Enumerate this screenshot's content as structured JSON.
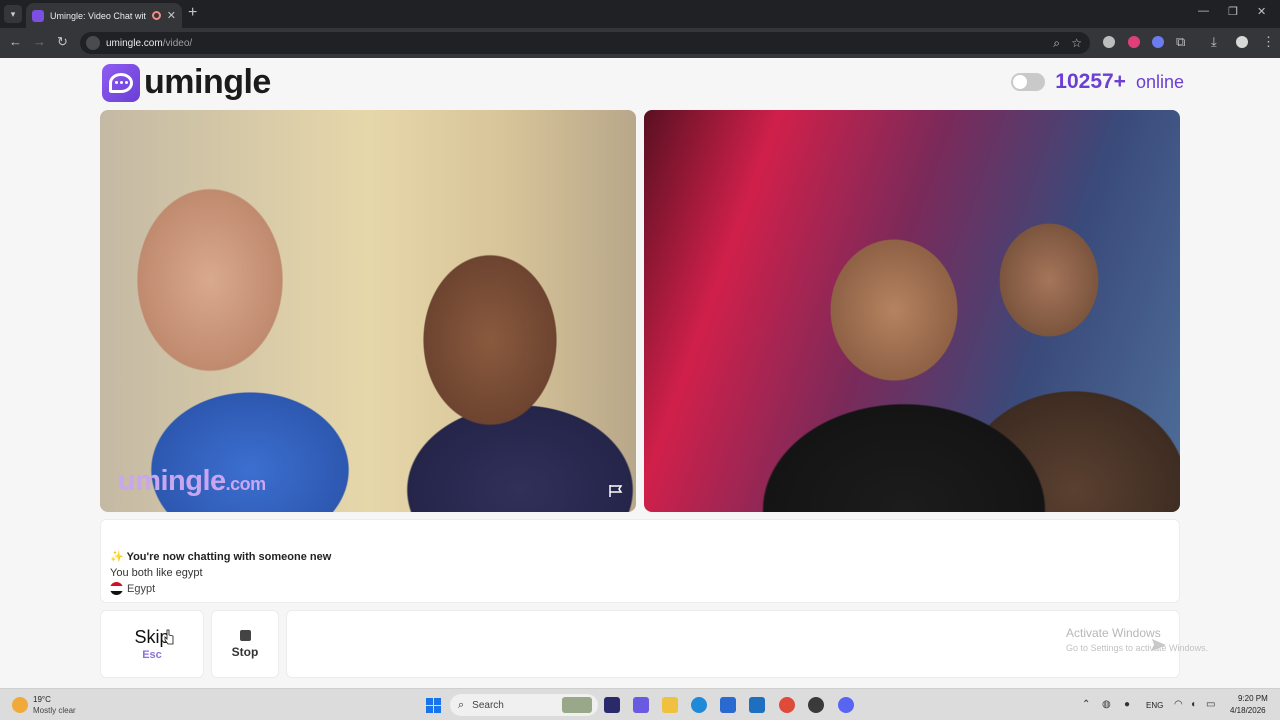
{
  "browser": {
    "tab_title": "Umingle: Video Chat with S",
    "url_host": "umingle.com",
    "url_path": "/video/",
    "new_tab_symbol": "+",
    "close_symbol": "✕",
    "minimize_symbol": "—",
    "restore_symbol": "❐",
    "win_close_symbol": "✕",
    "back_symbol": "←",
    "forward_symbol": "→",
    "reload_symbol": "↻",
    "zoom_symbol": "⌕",
    "bookmark_symbol": "☆",
    "extensions_symbol": "⧉",
    "download_symbol": "⤓",
    "menu_symbol": "⋮",
    "tab_menu_symbol": "▾"
  },
  "header": {
    "logo_text": "umingle",
    "online_count": "10257+",
    "online_label": "online"
  },
  "videos": {
    "watermark_main": "umingle",
    "watermark_suffix": ".com"
  },
  "chat": {
    "sparkle": "✨",
    "new_chat_message": "You're now chatting with someone new",
    "common_interest": "You both like egypt",
    "country": "Egypt"
  },
  "controls": {
    "skip_label": "Skip",
    "skip_key": "Esc",
    "stop_label": "Stop"
  },
  "os_overlay": {
    "activate_title": "Activate Windows",
    "activate_subtitle": "Go to Settings to activate Windows."
  },
  "taskbar": {
    "temperature": "19°C",
    "weather": "Mostly clear",
    "search_label": "Search",
    "language": "ENG",
    "time": "9:20 PM",
    "date": "4/18/2026",
    "tray_up_symbol": "⌃",
    "search_symbol": "⌕"
  },
  "colors": {
    "brand": "#6b3fd2",
    "watermark": "#c8a6f0",
    "skip_key": "#8a72d8"
  }
}
